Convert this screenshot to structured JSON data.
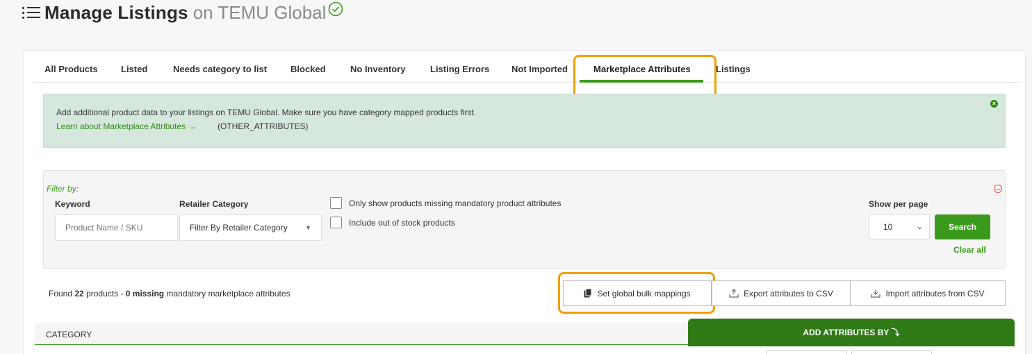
{
  "header": {
    "title_strong": "Manage Listings",
    "title_light": "on TEMU Global"
  },
  "tabs": [
    {
      "label": "All Products"
    },
    {
      "label": "Listed"
    },
    {
      "label": "Needs category to list"
    },
    {
      "label": "Blocked"
    },
    {
      "label": "No Inventory"
    },
    {
      "label": "Listing Errors"
    },
    {
      "label": "Not Imported"
    },
    {
      "label": "Marketplace Attributes",
      "active": true
    },
    {
      "label": "Listings"
    }
  ],
  "alert": {
    "text": "Add additional product data to your listings on TEMU Global. Make sure you have category mapped products first.",
    "link": "Learn about Marketplace Attributes",
    "code": "(OTHER_ATTRIBUTES)"
  },
  "filter": {
    "filter_by": "Filter by:",
    "keyword_label": "Keyword",
    "keyword_placeholder": "Product Name / SKU",
    "category_label": "Retailer Category",
    "category_value": "Filter By Retailer Category",
    "cb_missing": "Only show products missing mandatory product attributes",
    "cb_out_of_stock": "Include out of stock products",
    "per_page_label": "Show per page",
    "per_page_value": "10",
    "search_button": "Search",
    "clear_all": "Clear all"
  },
  "summary": {
    "found_prefix": "Found",
    "found_count": "22",
    "found_mid": "products -",
    "missing_count": "0 missing",
    "found_suffix": "mandatory marketplace attributes"
  },
  "actions": {
    "bulk_mappings": "Set global bulk mappings",
    "export_csv": "Export attributes to CSV",
    "import_csv": "Import attributes from CSV"
  },
  "table": {
    "col_category": "CATEGORY",
    "col_add_attributes": "ADD ATTRIBUTES BY"
  },
  "colors": {
    "accent_green": "#3a9a1d",
    "dark_green": "#2f7a17",
    "highlight_orange": "#f0a000",
    "alert_bg": "#d6e8dd"
  }
}
